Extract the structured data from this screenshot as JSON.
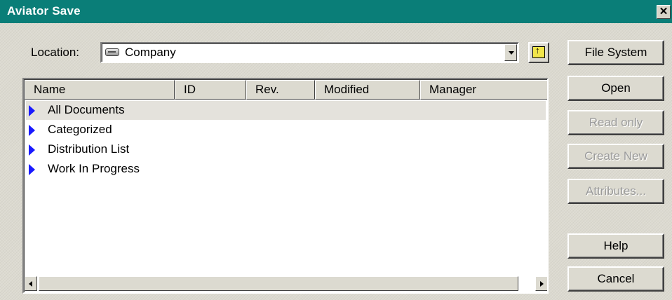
{
  "window": {
    "title": "Aviator Save",
    "close_glyph": "✕"
  },
  "location": {
    "label": "Location:",
    "value": "Company",
    "icon": "drive-icon"
  },
  "toolbar": {
    "up_folder_icon": "up-folder-icon"
  },
  "list": {
    "columns": [
      "Name",
      "ID",
      "Rev.",
      "Modified",
      "Manager"
    ],
    "rows": [
      {
        "label": "All Documents",
        "icon": "expand-arrow-icon",
        "selected": true
      },
      {
        "label": "Categorized",
        "icon": "expand-arrow-icon",
        "selected": false
      },
      {
        "label": "Distribution List",
        "icon": "expand-arrow-icon",
        "selected": false
      },
      {
        "label": "Work In Progress",
        "icon": "expand-arrow-icon",
        "selected": false
      }
    ]
  },
  "buttons": {
    "file_system": "File System",
    "open": "Open",
    "read_only": "Read only",
    "create_new": "Create New",
    "attributes": "Attributes...",
    "help": "Help",
    "cancel": "Cancel"
  }
}
